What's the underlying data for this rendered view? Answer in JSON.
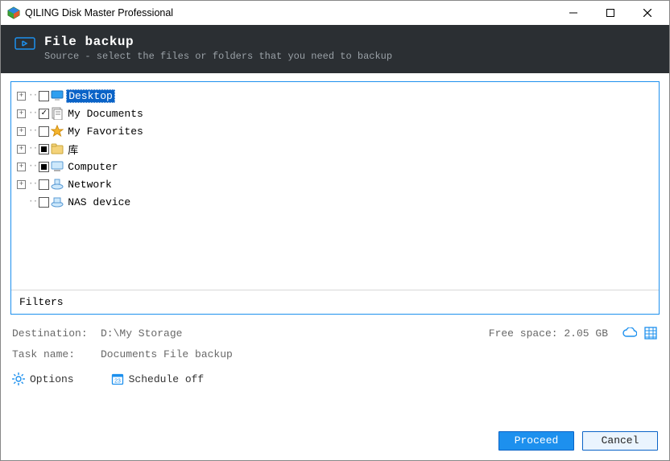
{
  "window": {
    "title": "QILING Disk Master Professional"
  },
  "header": {
    "title": "File backup",
    "subtitle": "Source - select the files or folders that you need to backup"
  },
  "tree": {
    "items": [
      {
        "label": "Desktop",
        "selected": true,
        "check": "unchecked",
        "expandable": true,
        "icon": "desktop"
      },
      {
        "label": "My Documents",
        "selected": false,
        "check": "checked",
        "expandable": true,
        "icon": "documents"
      },
      {
        "label": "My Favorites",
        "selected": false,
        "check": "unchecked",
        "expandable": true,
        "icon": "favorites"
      },
      {
        "label": "库",
        "selected": false,
        "check": "partial",
        "expandable": true,
        "icon": "libraries"
      },
      {
        "label": "Computer",
        "selected": false,
        "check": "partial",
        "expandable": true,
        "icon": "computer"
      },
      {
        "label": "Network",
        "selected": false,
        "check": "unchecked",
        "expandable": true,
        "icon": "network"
      },
      {
        "label": "NAS device",
        "selected": false,
        "check": "unchecked",
        "expandable": false,
        "icon": "nas"
      }
    ]
  },
  "filters": {
    "label": "Filters"
  },
  "destination": {
    "label": "Destination:",
    "value": "D:\\My Storage",
    "free_label": "Free space: 2.05 GB"
  },
  "task": {
    "label": "Task name:",
    "value": "Documents File backup"
  },
  "options": {
    "options_label": "Options",
    "schedule_label": "Schedule off"
  },
  "buttons": {
    "proceed": "Proceed",
    "cancel": "Cancel"
  }
}
